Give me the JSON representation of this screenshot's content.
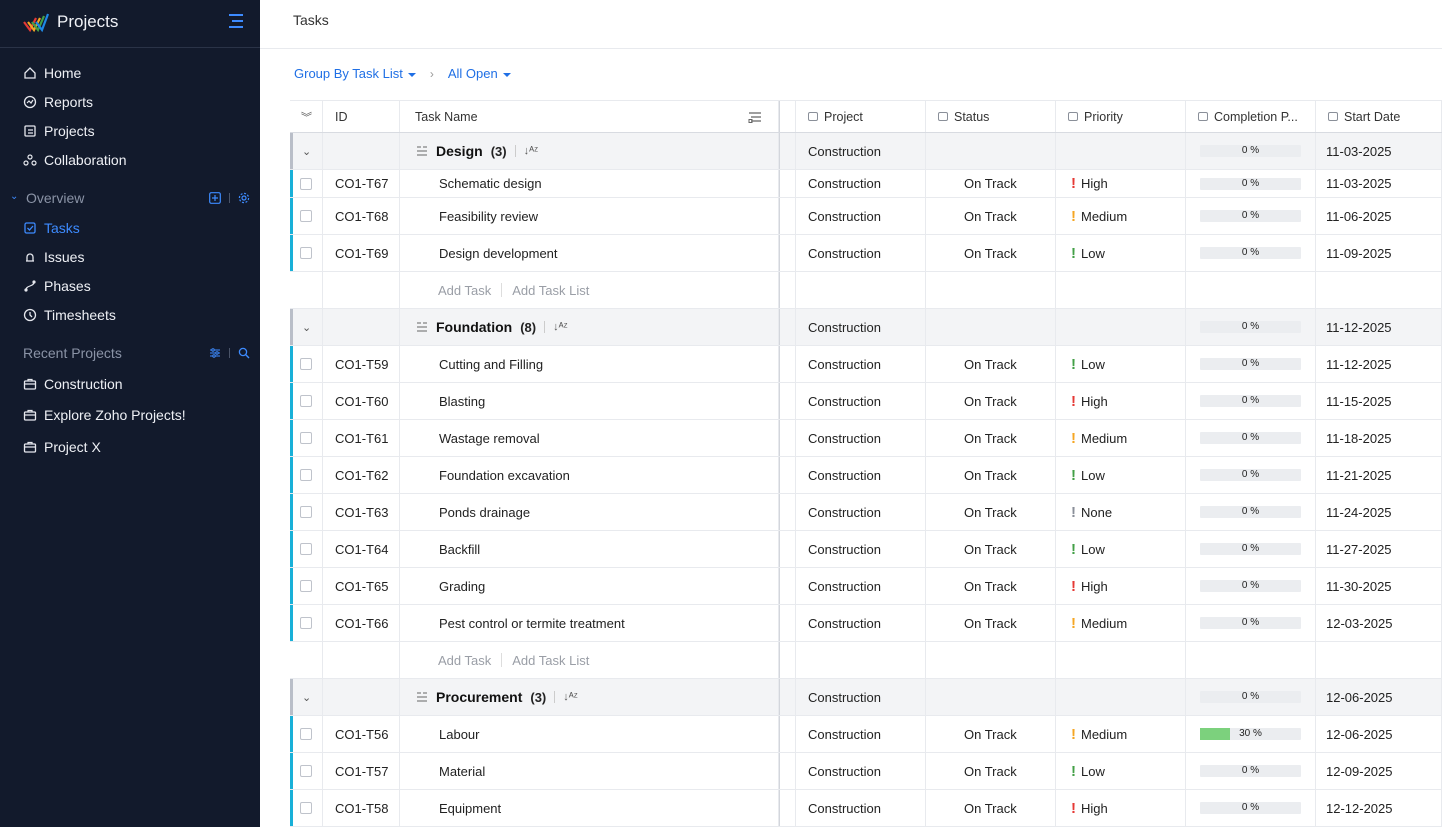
{
  "app": {
    "title": "Projects"
  },
  "sidebar": {
    "main_items": [
      {
        "label": "Home",
        "icon": "home-icon"
      },
      {
        "label": "Reports",
        "icon": "reports-icon"
      },
      {
        "label": "Projects",
        "icon": "projects-icon"
      },
      {
        "label": "Collaboration",
        "icon": "collaboration-icon"
      }
    ],
    "overview": {
      "label": "Overview",
      "items": [
        {
          "label": "Tasks",
          "icon": "tasks-icon",
          "active": true
        },
        {
          "label": "Issues",
          "icon": "issues-icon"
        },
        {
          "label": "Phases",
          "icon": "phases-icon"
        },
        {
          "label": "Timesheets",
          "icon": "timesheets-icon"
        }
      ]
    },
    "recent": {
      "label": "Recent Projects",
      "items": [
        {
          "label": "Construction",
          "icon": "briefcase-icon"
        },
        {
          "label": "Explore Zoho Projects!",
          "icon": "briefcase-icon"
        },
        {
          "label": "Project X",
          "icon": "briefcase-icon"
        }
      ]
    }
  },
  "page": {
    "title": "Tasks"
  },
  "filters": {
    "group_by": "Group By Task List",
    "view": "All Open"
  },
  "table": {
    "columns": {
      "id": "ID",
      "task_name": "Task Name",
      "project": "Project",
      "status": "Status",
      "priority": "Priority",
      "completion": "Completion P...",
      "start_date": "Start Date"
    },
    "add_task": "Add Task",
    "add_task_list": "Add Task List",
    "groups": [
      {
        "name": "Design",
        "count": "(3)",
        "project": "Construction",
        "completion": "0 %",
        "start_date": "11-03-2025",
        "tasks": [
          {
            "id": "CO1-T67",
            "name": "Schematic design",
            "project": "Construction",
            "status": "On Track",
            "priority": "High",
            "completion": "0 %",
            "percent": 0,
            "start_date": "11-03-2025"
          },
          {
            "id": "CO1-T68",
            "name": "Feasibility review",
            "project": "Construction",
            "status": "On Track",
            "priority": "Medium",
            "completion": "0 %",
            "percent": 0,
            "start_date": "11-06-2025"
          },
          {
            "id": "CO1-T69",
            "name": "Design development",
            "project": "Construction",
            "status": "On Track",
            "priority": "Low",
            "completion": "0 %",
            "percent": 0,
            "start_date": "11-09-2025"
          }
        ]
      },
      {
        "name": "Foundation",
        "count": "(8)",
        "project": "Construction",
        "completion": "0 %",
        "start_date": "11-12-2025",
        "tasks": [
          {
            "id": "CO1-T59",
            "name": "Cutting and Filling",
            "project": "Construction",
            "status": "On Track",
            "priority": "Low",
            "completion": "0 %",
            "percent": 0,
            "start_date": "11-12-2025"
          },
          {
            "id": "CO1-T60",
            "name": "Blasting",
            "project": "Construction",
            "status": "On Track",
            "priority": "High",
            "completion": "0 %",
            "percent": 0,
            "start_date": "11-15-2025"
          },
          {
            "id": "CO1-T61",
            "name": "Wastage removal",
            "project": "Construction",
            "status": "On Track",
            "priority": "Medium",
            "completion": "0 %",
            "percent": 0,
            "start_date": "11-18-2025"
          },
          {
            "id": "CO1-T62",
            "name": "Foundation excavation",
            "project": "Construction",
            "status": "On Track",
            "priority": "Low",
            "completion": "0 %",
            "percent": 0,
            "start_date": "11-21-2025"
          },
          {
            "id": "CO1-T63",
            "name": "Ponds drainage",
            "project": "Construction",
            "status": "On Track",
            "priority": "None",
            "completion": "0 %",
            "percent": 0,
            "start_date": "11-24-2025"
          },
          {
            "id": "CO1-T64",
            "name": "Backfill",
            "project": "Construction",
            "status": "On Track",
            "priority": "Low",
            "completion": "0 %",
            "percent": 0,
            "start_date": "11-27-2025"
          },
          {
            "id": "CO1-T65",
            "name": "Grading",
            "project": "Construction",
            "status": "On Track",
            "priority": "High",
            "completion": "0 %",
            "percent": 0,
            "start_date": "11-30-2025"
          },
          {
            "id": "CO1-T66",
            "name": "Pest control or termite treatment",
            "project": "Construction",
            "status": "On Track",
            "priority": "Medium",
            "completion": "0 %",
            "percent": 0,
            "start_date": "12-03-2025"
          }
        ]
      },
      {
        "name": "Procurement",
        "count": "(3)",
        "project": "Construction",
        "completion": "0 %",
        "start_date": "12-06-2025",
        "tasks": [
          {
            "id": "CO1-T56",
            "name": "Labour",
            "project": "Construction",
            "status": "On Track",
            "priority": "Medium",
            "completion": "30 %",
            "percent": 30,
            "start_date": "12-06-2025"
          },
          {
            "id": "CO1-T57",
            "name": "Material",
            "project": "Construction",
            "status": "On Track",
            "priority": "Low",
            "completion": "0 %",
            "percent": 0,
            "start_date": "12-09-2025"
          },
          {
            "id": "CO1-T58",
            "name": "Equipment",
            "project": "Construction",
            "status": "On Track",
            "priority": "High",
            "completion": "0 %",
            "percent": 0,
            "start_date": "12-12-2025"
          }
        ]
      }
    ]
  },
  "priority_colors": {
    "High": "#e53935",
    "Medium": "#f5a623",
    "Low": "#43a047",
    "None": "#8a8f99"
  },
  "colors": {
    "sidebar_bg": "#121a2c",
    "accent": "#3d8bff",
    "row_accent": "#18b0d8"
  }
}
